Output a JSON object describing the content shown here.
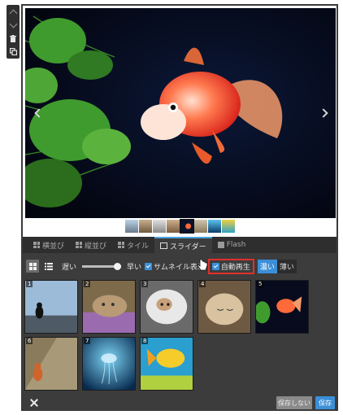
{
  "toolbar": {
    "icons": [
      "chevron-up-icon",
      "chevron-down-icon",
      "trash-icon",
      "duplicate-icon"
    ]
  },
  "slider": {
    "prev_icon": "chevron-left-icon",
    "next_icon": "chevron-right-icon"
  },
  "tabs": [
    {
      "label": "横並び",
      "icon": "grid-icon"
    },
    {
      "label": "縦並び",
      "icon": "grid-icon"
    },
    {
      "label": "タイル",
      "icon": "grid-icon"
    },
    {
      "label": "スライダー",
      "icon": "slider-icon",
      "active": true
    },
    {
      "label": "Flash",
      "icon": "flash-icon"
    }
  ],
  "options": {
    "speed_slow": "遅い",
    "speed_fast": "早い",
    "speed_level": 0.9,
    "show_thumbnails": "サムネイル表示",
    "autoplay": "自動再生",
    "dark": "濃い",
    "light": "薄い"
  },
  "images": [
    {
      "num": "1"
    },
    {
      "num": "2"
    },
    {
      "num": "3"
    },
    {
      "num": "4"
    },
    {
      "num": "5"
    },
    {
      "num": "6"
    },
    {
      "num": "7"
    },
    {
      "num": "8"
    }
  ],
  "footer": {
    "no_save": "保存しない",
    "save": "保存"
  },
  "colors": {
    "accent": "#3b8fd8",
    "highlight": "#e0302a",
    "panel": "#3c3c3c"
  }
}
